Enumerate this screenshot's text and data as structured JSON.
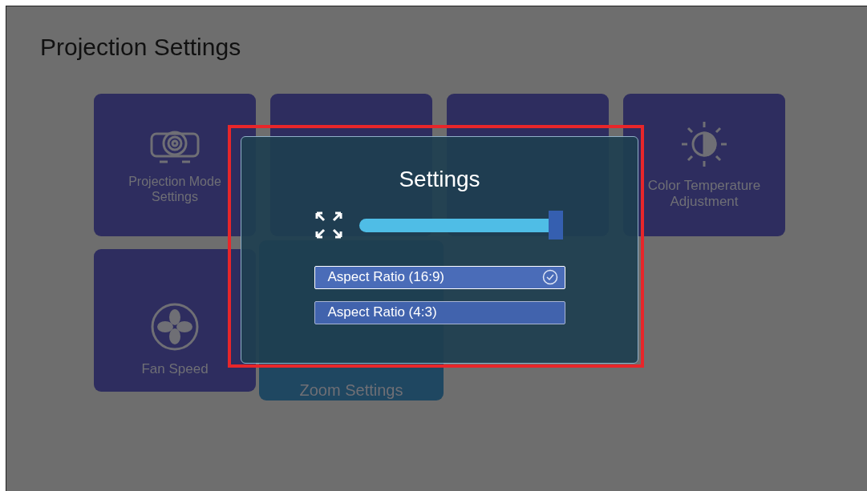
{
  "page": {
    "title": "Projection Settings"
  },
  "tiles": [
    {
      "label": "Projection Mode Settings",
      "kind": "projector",
      "focused": false
    },
    {
      "focused": false
    },
    {
      "focused": false
    },
    {
      "label": "Color Temperature Adjustment",
      "kind": "halfsun",
      "focused": false
    },
    {
      "label": "Fan Speed",
      "kind": "fan",
      "focused": false
    },
    {
      "label": "Zoom Settings",
      "focused": true
    }
  ],
  "dialog": {
    "title": "Settings",
    "slider": {
      "level": 0.97
    },
    "options": [
      {
        "label": "Aspect Ratio (16:9)",
        "selected": true
      },
      {
        "label": "Aspect Ratio (4:3)",
        "selected": false
      }
    ]
  }
}
